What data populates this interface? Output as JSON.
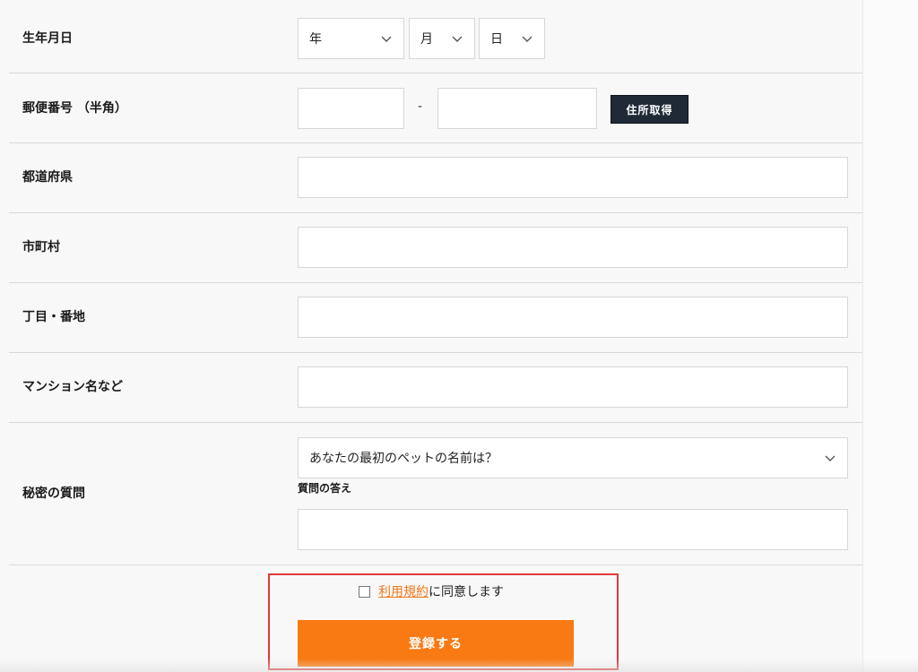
{
  "form": {
    "birthdate": {
      "label": "生年月日",
      "year": "年",
      "month": "月",
      "day": "日"
    },
    "postal": {
      "label": "郵便番号 （半角）",
      "separator": "-",
      "button": "住所取得"
    },
    "prefecture": {
      "label": "都道府県"
    },
    "city": {
      "label": "市町村"
    },
    "street": {
      "label": "丁目・番地"
    },
    "building": {
      "label": "マンション名など"
    },
    "secret": {
      "label": "秘密の質問",
      "question": "あなたの最初のペットの名前は？",
      "answer_label": "質問の答え"
    }
  },
  "agreement": {
    "link_text": "利用規約",
    "suffix": "に同意します",
    "link_color": "#f0781e"
  },
  "submit": {
    "label": "登録する",
    "color": "#f97a12"
  },
  "highlight_color": "#e03a3a"
}
